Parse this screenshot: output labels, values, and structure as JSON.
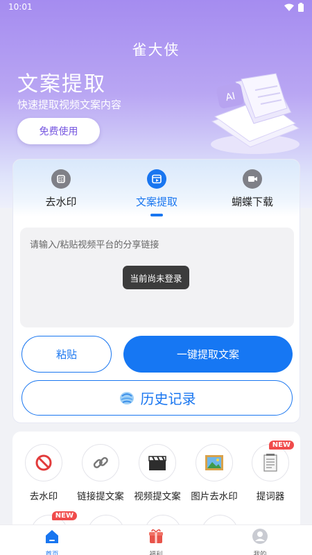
{
  "status": {
    "time": "10:01"
  },
  "app_title": "雀大侠",
  "hero": {
    "heading": "文案提取",
    "subtitle": "快速提取视频文案内容",
    "free_button": "免费使用"
  },
  "tabs": [
    {
      "label": "去水印",
      "icon": "watermark-icon",
      "active": false
    },
    {
      "label": "文案提取",
      "icon": "video-text-icon",
      "active": true
    },
    {
      "label": "蝴蝶下载",
      "icon": "download-video-icon",
      "active": false
    }
  ],
  "input": {
    "placeholder": "请输入/粘贴视频平台的分享链接",
    "value": ""
  },
  "toast": "当前尚未登录",
  "buttons": {
    "paste": "粘贴",
    "extract": "一键提取文案",
    "history": "历史记录"
  },
  "tools": [
    {
      "label": "去水印",
      "icon": "no-sign-icon",
      "badge": ""
    },
    {
      "label": "链接提文案",
      "icon": "link-icon",
      "badge": ""
    },
    {
      "label": "视频提文案",
      "icon": "clapperboard-icon",
      "badge": ""
    },
    {
      "label": "图片去水印",
      "icon": "picture-icon",
      "badge": ""
    },
    {
      "label": "提词器",
      "icon": "notepad-icon",
      "badge": "NEW"
    }
  ],
  "tools_row2_badge": "NEW",
  "nav": [
    {
      "label": "首页",
      "icon": "home-icon",
      "active": true
    },
    {
      "label": "福利",
      "icon": "gift-box-icon",
      "active": false
    },
    {
      "label": "我的",
      "icon": "profile-icon",
      "active": false
    }
  ],
  "colors": {
    "accent": "#1976f0",
    "hero_purple": "#a58cf0",
    "badge_red": "#f04b4b"
  }
}
